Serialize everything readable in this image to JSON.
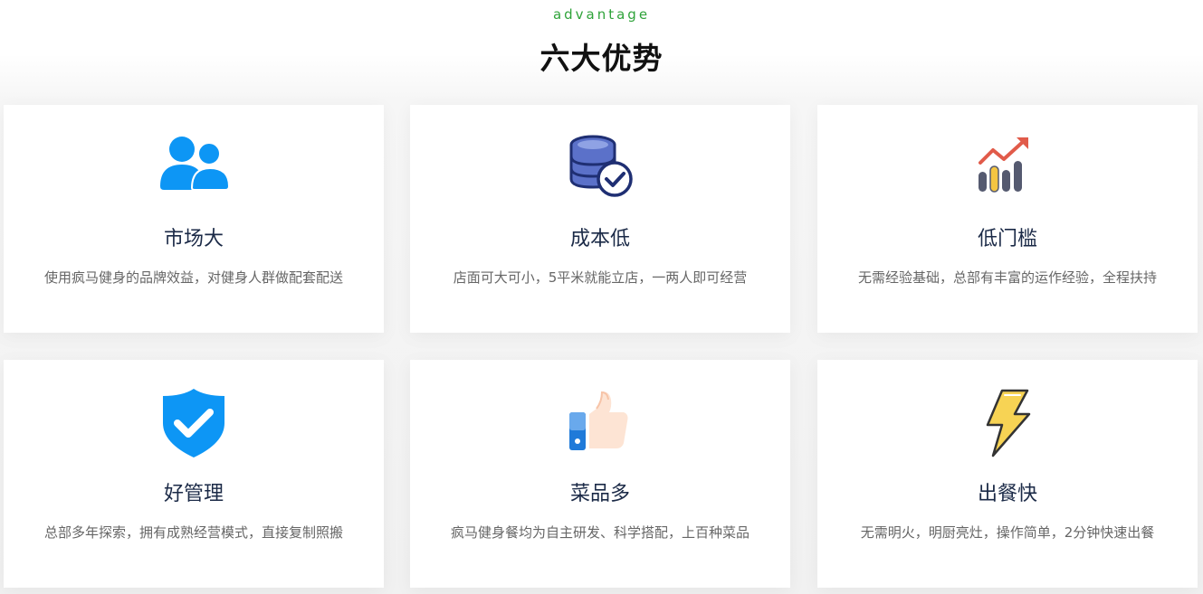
{
  "header": {
    "subtitle": "advantage",
    "title": "六大优势"
  },
  "colors": {
    "accent_green": "#2fa33a",
    "title_dark": "#1b2a47",
    "icon_blue": "#0d96f5"
  },
  "cards": [
    {
      "icon": "users-icon",
      "title": "市场大",
      "desc": "使用疯马健身的品牌效益，对健身人群做配套配送"
    },
    {
      "icon": "database-check-icon",
      "title": "成本低",
      "desc": "店面可大可小，5平米就能立店，一两人即可经营"
    },
    {
      "icon": "growth-chart-icon",
      "title": "低门槛",
      "desc": "无需经验基础，总部有丰富的运作经验，全程扶持"
    },
    {
      "icon": "shield-check-icon",
      "title": "好管理",
      "desc": "总部多年探索，拥有成熟经营模式，直接复制照搬"
    },
    {
      "icon": "thumbs-up-icon",
      "title": "菜品多",
      "desc": "疯马健身餐均为自主研发、科学搭配，上百种菜品"
    },
    {
      "icon": "lightning-icon",
      "title": "出餐快",
      "desc": "无需明火，明厨亮灶，操作简单，2分钟快速出餐"
    }
  ]
}
